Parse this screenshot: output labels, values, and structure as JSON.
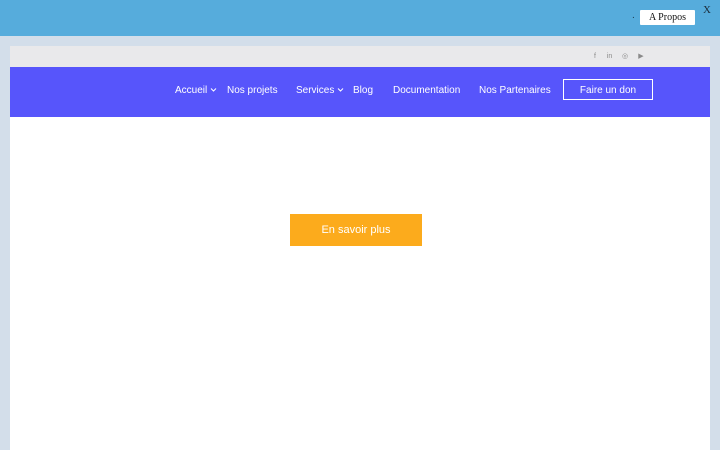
{
  "topbar": {
    "dot": ".",
    "about_label": "A Propos",
    "close_label": "X"
  },
  "social": {
    "icons": [
      "facebook-icon",
      "linkedin-icon",
      "instagram-icon",
      "youtube-icon"
    ],
    "glyphs": [
      "f",
      "in",
      "◎",
      "▶"
    ]
  },
  "nav": {
    "items": [
      {
        "label": "Accueil",
        "has_dropdown": true
      },
      {
        "label": "Nos projets",
        "has_dropdown": false
      },
      {
        "label": "Services",
        "has_dropdown": true
      },
      {
        "label": "Blog",
        "has_dropdown": false
      },
      {
        "label": "Documentation",
        "has_dropdown": false
      },
      {
        "label": "Nos Partenaires",
        "has_dropdown": false
      }
    ],
    "donate_label": "Faire un don"
  },
  "hero": {
    "cta_label": "En savoir plus"
  },
  "colors": {
    "topbar": "#56acdc",
    "nav": "#5755fb",
    "cta": "#fcab1c",
    "frame": "#d3deea"
  }
}
